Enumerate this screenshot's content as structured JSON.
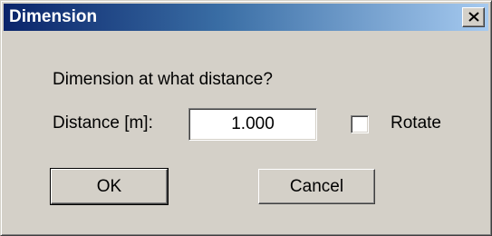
{
  "dialog": {
    "title": "Dimension",
    "prompt": "Dimension at what distance?",
    "distance_label": "Distance [m]:",
    "distance_value": "1.000",
    "rotate_label": "Rotate",
    "rotate_checked": false,
    "ok_label": "OK",
    "cancel_label": "Cancel"
  },
  "icons": {
    "close": "close-icon"
  },
  "colors": {
    "title_start": "#0a246a",
    "title_end": "#a6caf0",
    "face": "#d4d0c8"
  }
}
